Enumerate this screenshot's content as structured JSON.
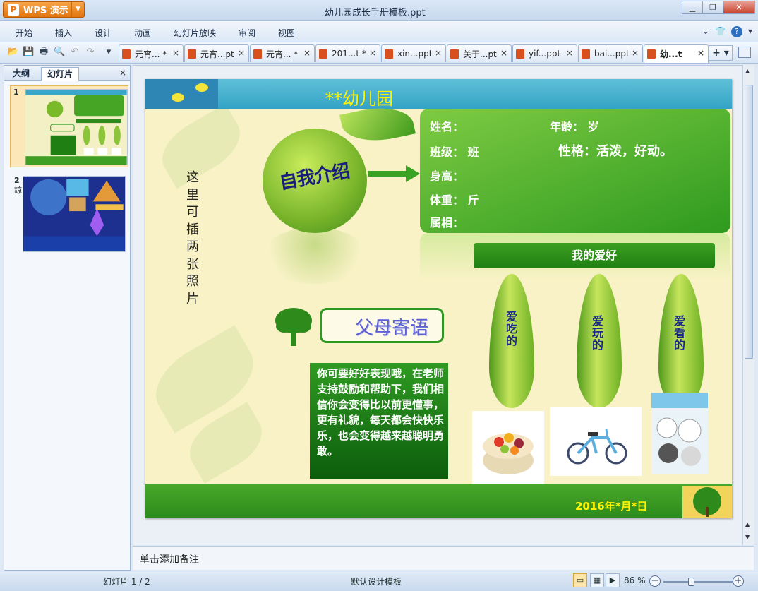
{
  "app": {
    "name": "WPS 演示",
    "window_title": "幼儿园成长手册模板.ppt"
  },
  "menu": {
    "items": [
      "开始",
      "插入",
      "设计",
      "动画",
      "幻灯片放映",
      "审阅",
      "视图"
    ]
  },
  "doc_tabs": [
    {
      "label": "元宵... *"
    },
    {
      "label": "元宵...pt"
    },
    {
      "label": "元宵... *"
    },
    {
      "label": "201...t *"
    },
    {
      "label": "xin...ppt"
    },
    {
      "label": "关于...pt"
    },
    {
      "label": "yif...ppt"
    },
    {
      "label": "bai...ppt"
    },
    {
      "label": "幼...t"
    }
  ],
  "left_panel": {
    "tab_outline": "大纲",
    "tab_slides": "幻灯片",
    "close": "×",
    "thumb1_num": "1",
    "thumb2_num": "2",
    "thumb2_extra": "諒"
  },
  "slide": {
    "kindergarten_title": "**幼儿园",
    "self_intro": "自我介绍",
    "info": {
      "name": "姓名：",
      "age": "年龄：   岁",
      "class": "班级：   班",
      "personality": "性格：活泼，好动。",
      "height": "身高：",
      "weight": "体重：   斤",
      "zodiac": "属相："
    },
    "photo_hint": "这里可插两张照片",
    "hobby_title": "我的爱好",
    "hobbies": [
      "爱吃的",
      "爱玩的",
      "爱看的"
    ],
    "parents_title": "父母寄语",
    "parents_message": "你可要好好表现哦，在老师支持鼓励和帮助下，我们相信你会变得比以前更懂事，更有礼貌，每天都会快快乐乐，也会变得越来越聪明勇敢。",
    "date": "2016年*月*日"
  },
  "notes_placeholder": "单击添加备注",
  "status": {
    "slide_counter": "幻灯片 1 / 2",
    "template": "默认设计模板",
    "zoom": "86 %"
  }
}
